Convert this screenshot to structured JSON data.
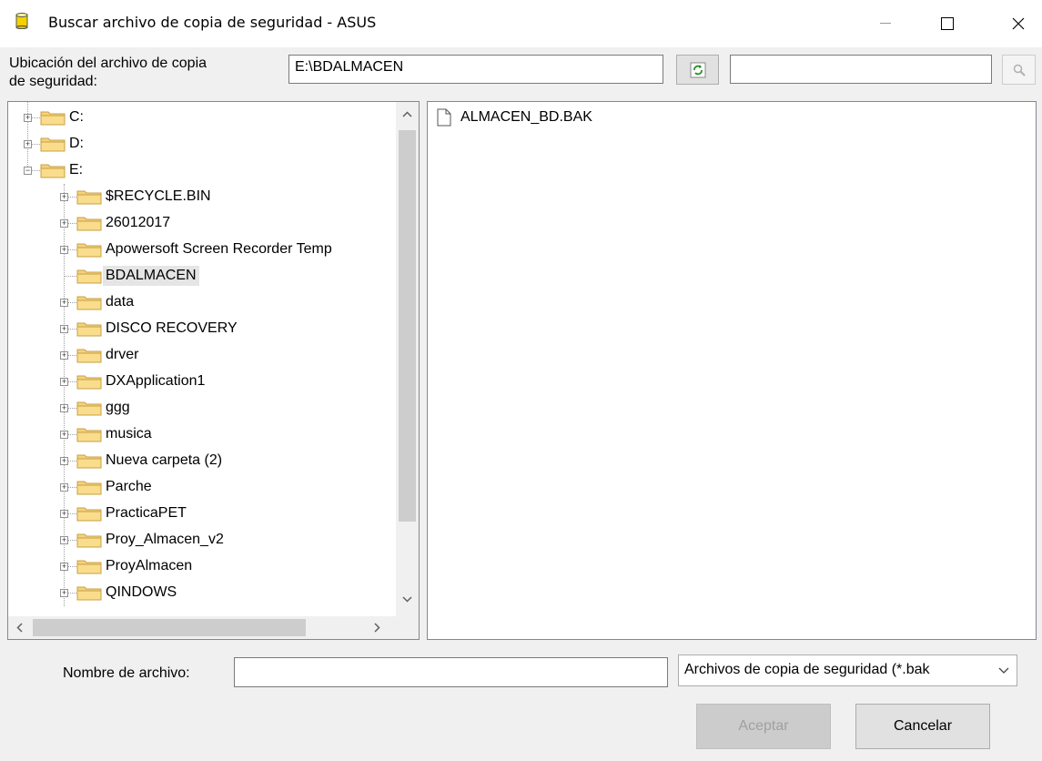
{
  "window": {
    "title": "Buscar archivo de copia de seguridad - ASUS"
  },
  "location": {
    "label_line1": "Ubicación del archivo de copia",
    "label_line2": "de seguridad:",
    "path_value": "E:\\BDALMACEN",
    "search_value": ""
  },
  "tree": {
    "items": [
      {
        "label": "C:",
        "level": 0,
        "expander": "+"
      },
      {
        "label": "D:",
        "level": 0,
        "expander": "+"
      },
      {
        "label": "E:",
        "level": 0,
        "expander": "-"
      },
      {
        "label": "$RECYCLE.BIN",
        "level": 1,
        "expander": "+"
      },
      {
        "label": "26012017",
        "level": 1,
        "expander": "+"
      },
      {
        "label": "Apowersoft Screen Recorder Temp",
        "level": 1,
        "expander": "+"
      },
      {
        "label": "BDALMACEN",
        "level": 1,
        "expander": "",
        "selected": true
      },
      {
        "label": "data",
        "level": 1,
        "expander": "+"
      },
      {
        "label": "DISCO RECOVERY",
        "level": 1,
        "expander": "+"
      },
      {
        "label": "drver",
        "level": 1,
        "expander": "+"
      },
      {
        "label": "DXApplication1",
        "level": 1,
        "expander": "+"
      },
      {
        "label": "ggg",
        "level": 1,
        "expander": "+"
      },
      {
        "label": "musica",
        "level": 1,
        "expander": "+"
      },
      {
        "label": "Nueva carpeta (2)",
        "level": 1,
        "expander": "+"
      },
      {
        "label": "Parche",
        "level": 1,
        "expander": "+"
      },
      {
        "label": "PracticaPET",
        "level": 1,
        "expander": "+"
      },
      {
        "label": "Proy_Almacen_v2",
        "level": 1,
        "expander": "+"
      },
      {
        "label": "ProyAlmacen",
        "level": 1,
        "expander": "+"
      },
      {
        "label": "QINDOWS",
        "level": 1,
        "expander": "+"
      }
    ]
  },
  "files": [
    {
      "name": "ALMACEN_BD.BAK"
    }
  ],
  "footer": {
    "filename_label": "Nombre de archivo:",
    "filename_value": "",
    "filter_value": "Archivos de copia de seguridad (*.bak",
    "accept_label": "Aceptar",
    "cancel_label": "Cancelar"
  },
  "icons": {
    "app": "database-icon",
    "minimize": "minimize-icon",
    "maximize": "maximize-icon",
    "close": "close-icon",
    "refresh": "refresh-icon",
    "search": "search-icon",
    "folder": "folder-icon",
    "file": "file-icon"
  },
  "colors": {
    "folder": "#f5d27a",
    "folder_edge": "#c8a045",
    "disabled_text": "#a0a0a0"
  }
}
